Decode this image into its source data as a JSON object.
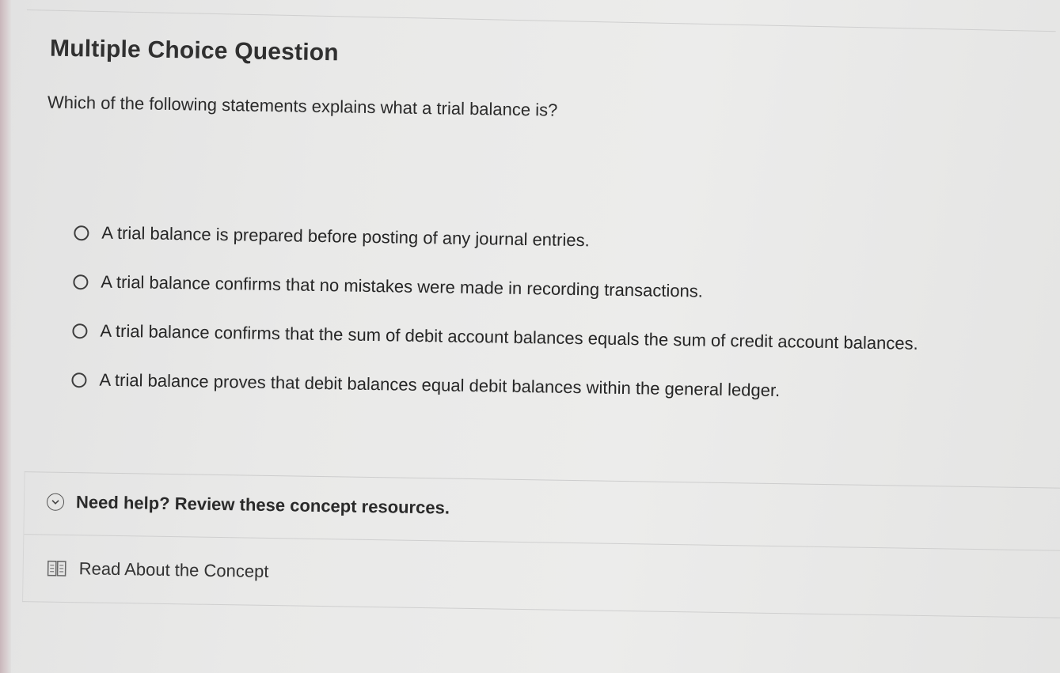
{
  "question": {
    "type_label": "Multiple Choice Question",
    "prompt": "Which of the following statements explains what a trial balance is?"
  },
  "options": [
    {
      "label": "A trial balance is prepared before posting of any journal entries."
    },
    {
      "label": "A trial balance confirms that no mistakes were made in recording transactions."
    },
    {
      "label": "A trial balance confirms that the sum of debit account balances equals the sum of credit account balances."
    },
    {
      "label": "A trial balance proves that debit balances equal debit balances within the general ledger."
    }
  ],
  "help": {
    "title": "Need help? Review these concept resources.",
    "icon": "chevron-down-circle-icon",
    "resources": [
      {
        "label": "Read About the Concept",
        "icon": "book-icon"
      }
    ]
  }
}
